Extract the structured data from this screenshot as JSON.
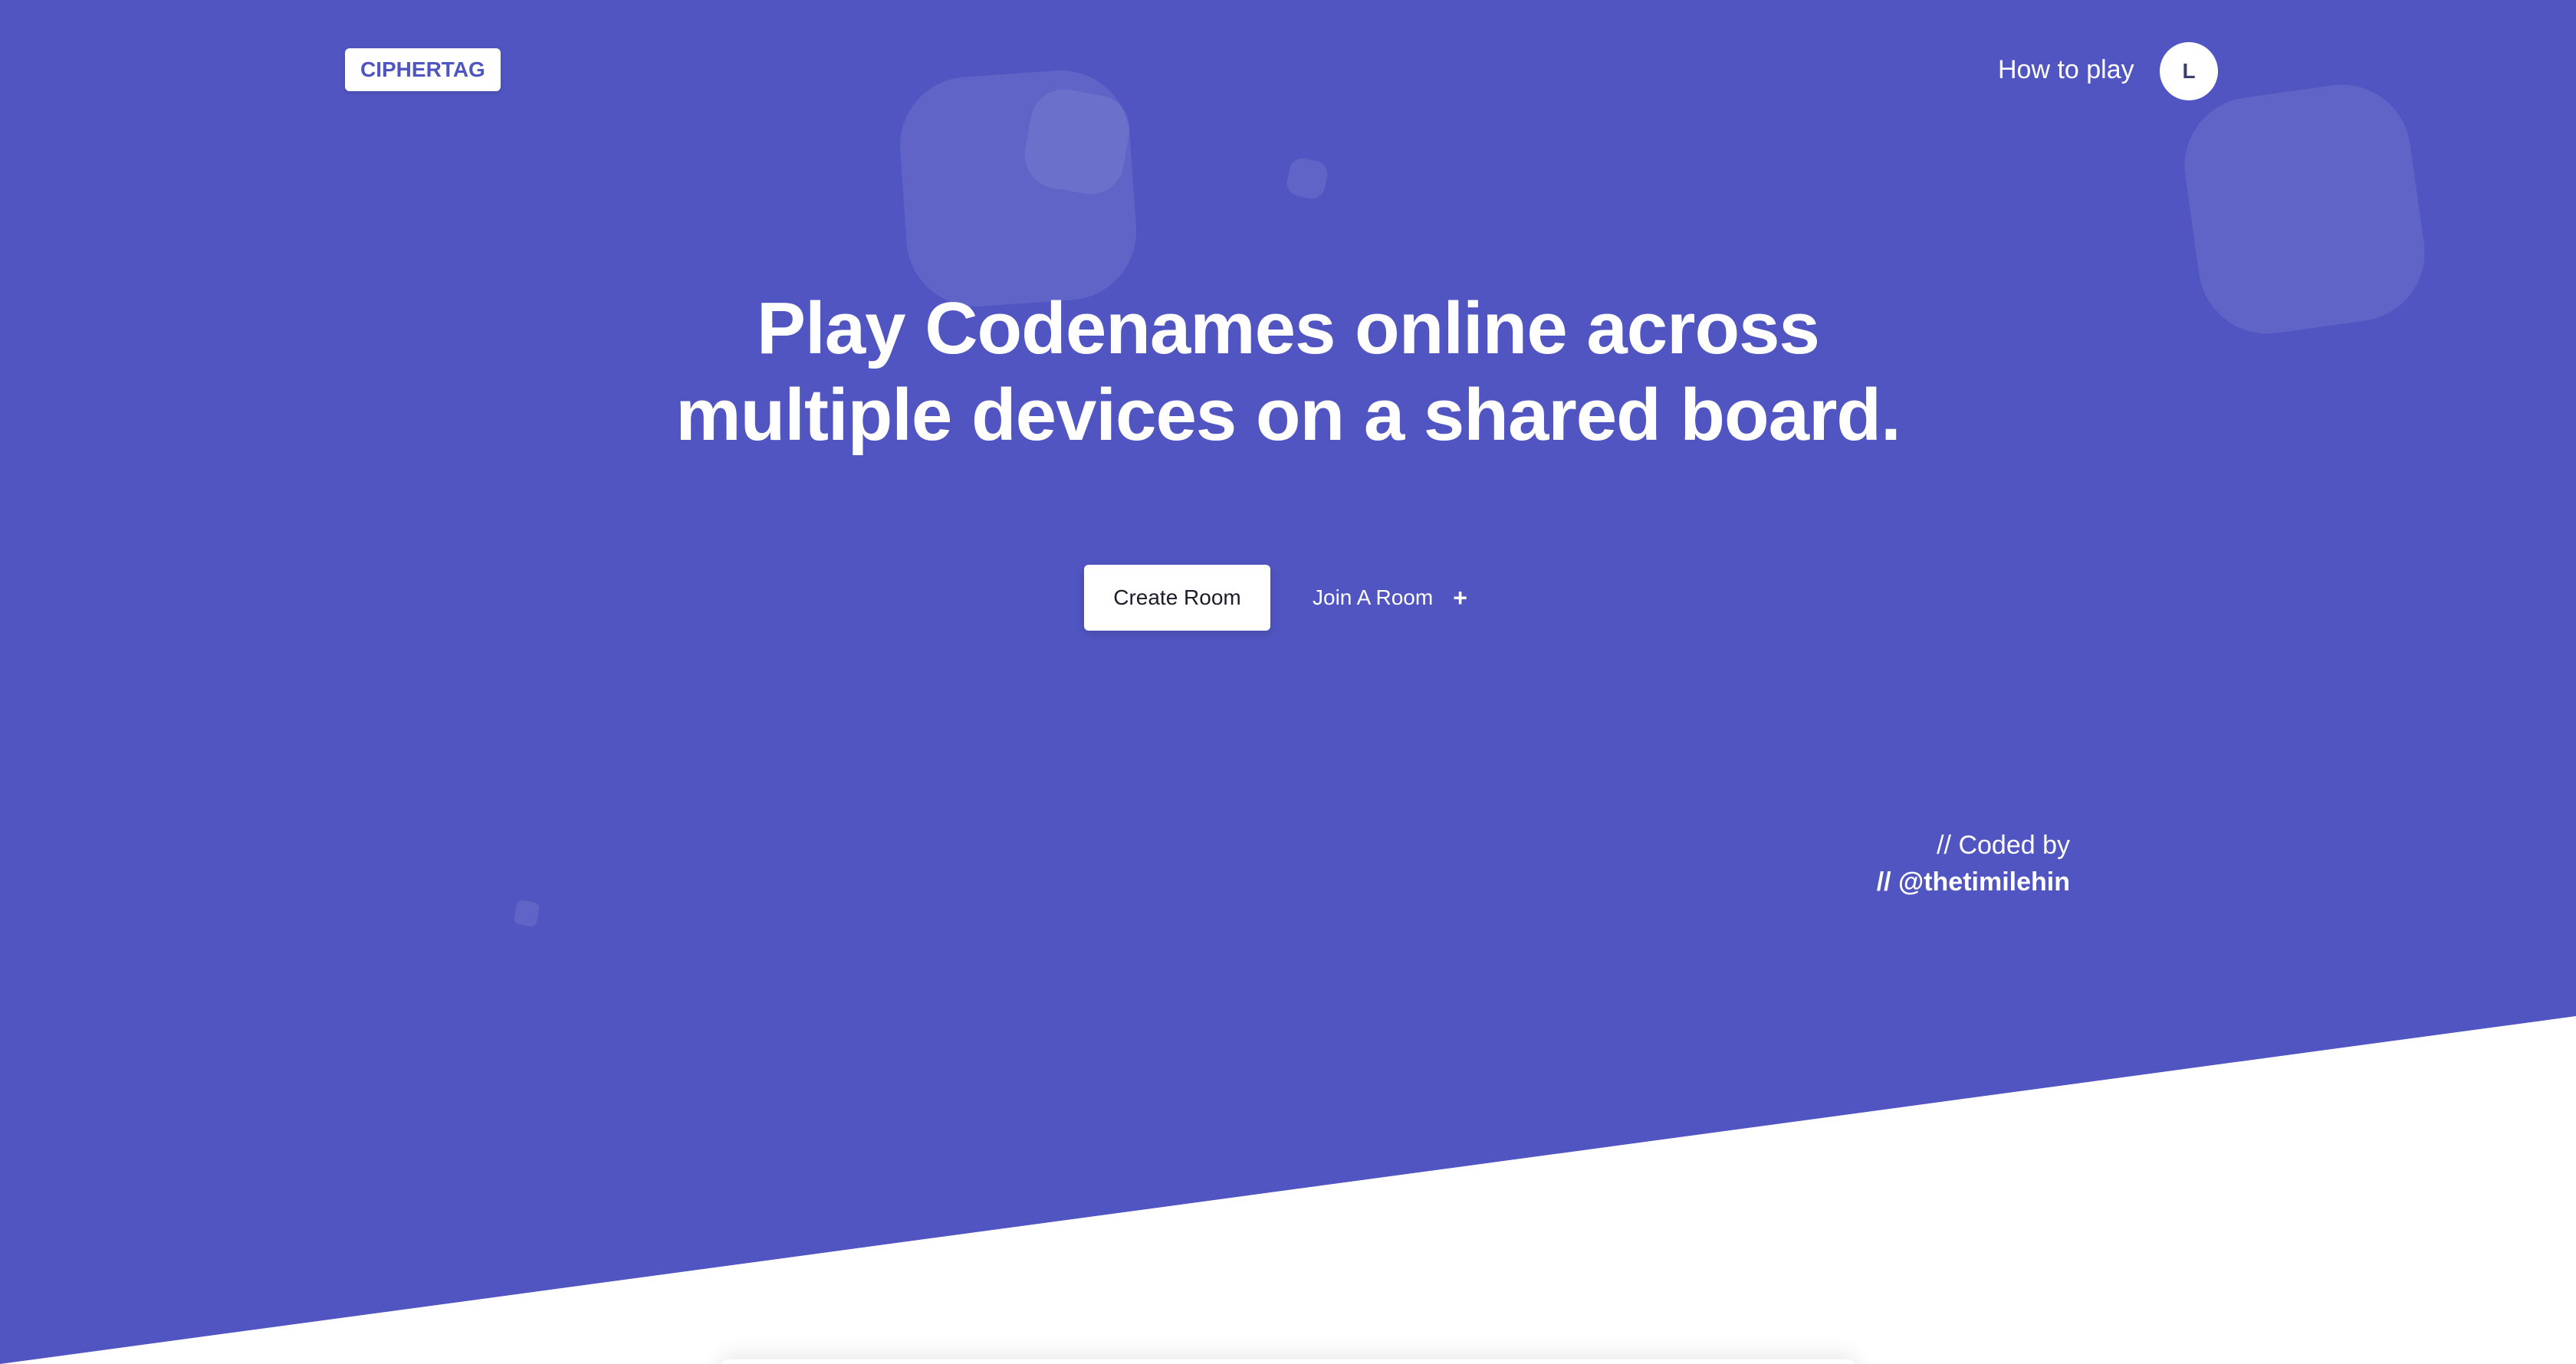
{
  "colors": {
    "hero_background": "#5055c1",
    "below_fold_background": "#ffffff",
    "logo_text": "#4f55c1"
  },
  "header": {
    "logo": "CIPHERTAG",
    "nav_link": "How to play",
    "avatar_initial": "L"
  },
  "hero": {
    "headline": "Play Codenames online across multiple devices on a shared board.",
    "create_button": "Create Room",
    "join_button": "Join A Room",
    "join_icon": "plus-icon",
    "join_icon_glyph": "+"
  },
  "credit": {
    "line1": "// Coded by",
    "line2": "// @thetimilehin"
  }
}
